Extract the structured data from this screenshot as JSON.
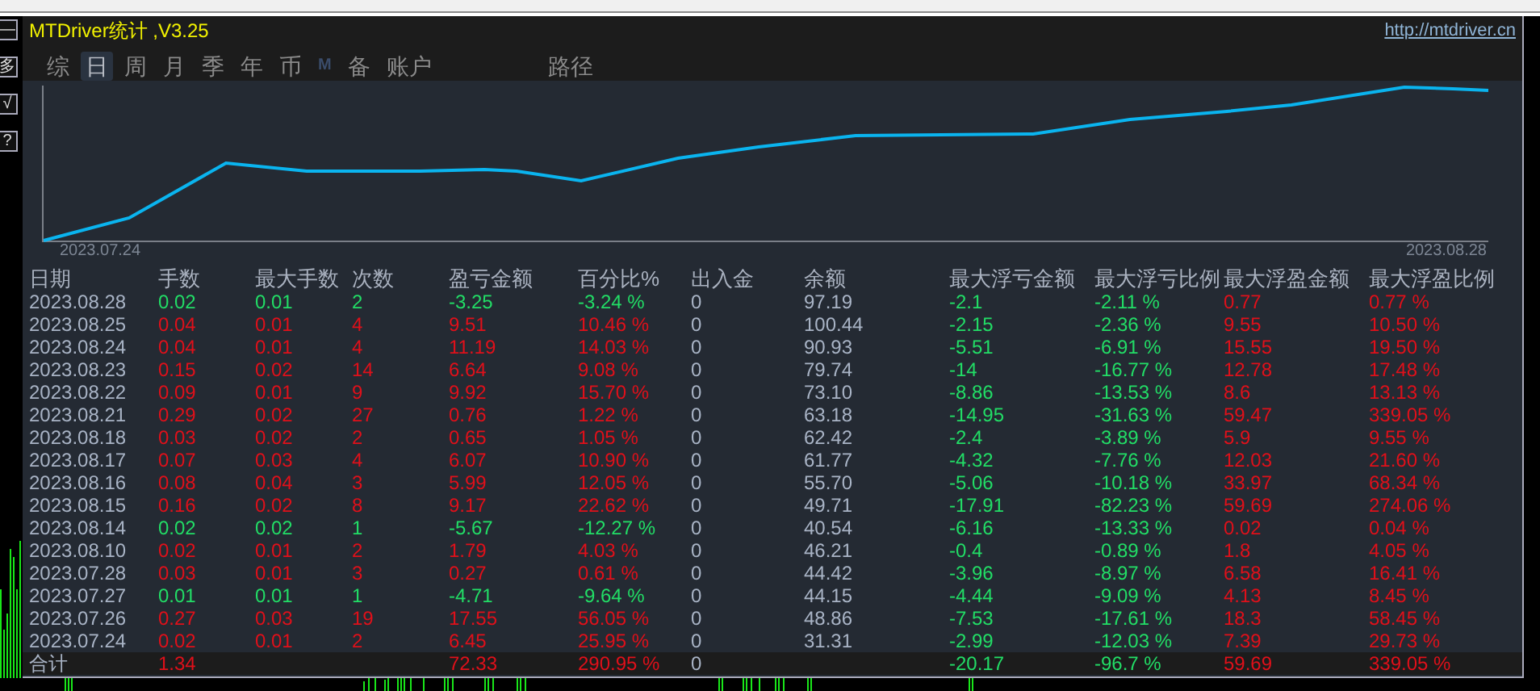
{
  "side_buttons": [
    "—",
    "多",
    "√",
    "?"
  ],
  "panel": {
    "title": "MTDriver统计 ,V3.25",
    "url": "http://mtdriver.cn"
  },
  "tabs": [
    {
      "label": "综",
      "selected": false,
      "disabled": false
    },
    {
      "label": "日",
      "selected": true,
      "disabled": false
    },
    {
      "label": "周",
      "selected": false,
      "disabled": false
    },
    {
      "label": "月",
      "selected": false,
      "disabled": false
    },
    {
      "label": "季",
      "selected": false,
      "disabled": false
    },
    {
      "label": "年",
      "selected": false,
      "disabled": false
    },
    {
      "label": "币",
      "selected": false,
      "disabled": false
    },
    {
      "label": "M",
      "selected": false,
      "disabled": true
    },
    {
      "label": "备",
      "selected": false,
      "disabled": false
    },
    {
      "label": "账户",
      "selected": false,
      "disabled": false
    }
  ],
  "path_button": "路径",
  "equity_chart": {
    "start_label": "2023.07.24",
    "end_label": "2023.08.28"
  },
  "table": {
    "columns": [
      {
        "label": "日期",
        "kind": "plain"
      },
      {
        "label": "手数",
        "kind": "result"
      },
      {
        "label": "最大手数",
        "kind": "result"
      },
      {
        "label": "次数",
        "kind": "result"
      },
      {
        "label": "盈亏金额",
        "kind": "result"
      },
      {
        "label": "百分比%",
        "kind": "result"
      },
      {
        "label": "出入金",
        "kind": "plain"
      },
      {
        "label": "余额",
        "kind": "plain"
      },
      {
        "label": "最大浮亏金额",
        "kind": "loss"
      },
      {
        "label": "最大浮亏比例",
        "kind": "loss"
      },
      {
        "label": "最大浮盈金额",
        "kind": "profit"
      },
      {
        "label": "最大浮盈比例",
        "kind": "profit"
      }
    ],
    "rows": [
      {
        "kind": "loss",
        "cells": [
          "2023.08.28",
          "0.02",
          "0.01",
          "2",
          "-3.25",
          "-3.24 %",
          "0",
          "97.19",
          "-2.1",
          "-2.11 %",
          "0.77",
          "0.77 %"
        ]
      },
      {
        "kind": "profit",
        "cells": [
          "2023.08.25",
          "0.04",
          "0.01",
          "4",
          "9.51",
          "10.46 %",
          "0",
          "100.44",
          "-2.15",
          "-2.36 %",
          "9.55",
          "10.50 %"
        ]
      },
      {
        "kind": "profit",
        "cells": [
          "2023.08.24",
          "0.04",
          "0.01",
          "4",
          "11.19",
          "14.03 %",
          "0",
          "90.93",
          "-5.51",
          "-6.91 %",
          "15.55",
          "19.50 %"
        ]
      },
      {
        "kind": "profit",
        "cells": [
          "2023.08.23",
          "0.15",
          "0.02",
          "14",
          "6.64",
          "9.08 %",
          "0",
          "79.74",
          "-14",
          "-16.77 %",
          "12.78",
          "17.48 %"
        ]
      },
      {
        "kind": "profit",
        "cells": [
          "2023.08.22",
          "0.09",
          "0.01",
          "9",
          "9.92",
          "15.70 %",
          "0",
          "73.10",
          "-8.86",
          "-13.53 %",
          "8.6",
          "13.13 %"
        ]
      },
      {
        "kind": "profit",
        "cells": [
          "2023.08.21",
          "0.29",
          "0.02",
          "27",
          "0.76",
          "1.22 %",
          "0",
          "63.18",
          "-14.95",
          "-31.63 %",
          "59.47",
          "339.05 %"
        ]
      },
      {
        "kind": "profit",
        "cells": [
          "2023.08.18",
          "0.03",
          "0.02",
          "2",
          "0.65",
          "1.05 %",
          "0",
          "62.42",
          "-2.4",
          "-3.89 %",
          "5.9",
          "9.55 %"
        ]
      },
      {
        "kind": "profit",
        "cells": [
          "2023.08.17",
          "0.07",
          "0.03",
          "4",
          "6.07",
          "10.90 %",
          "0",
          "61.77",
          "-4.32",
          "-7.76 %",
          "12.03",
          "21.60 %"
        ]
      },
      {
        "kind": "profit",
        "cells": [
          "2023.08.16",
          "0.08",
          "0.04",
          "3",
          "5.99",
          "12.05 %",
          "0",
          "55.70",
          "-5.06",
          "-10.18 %",
          "33.97",
          "68.34 %"
        ]
      },
      {
        "kind": "profit",
        "cells": [
          "2023.08.15",
          "0.16",
          "0.02",
          "8",
          "9.17",
          "22.62 %",
          "0",
          "49.71",
          "-17.91",
          "-82.23 %",
          "59.69",
          "274.06 %"
        ]
      },
      {
        "kind": "loss",
        "cells": [
          "2023.08.14",
          "0.02",
          "0.02",
          "1",
          "-5.67",
          "-12.27 %",
          "0",
          "40.54",
          "-6.16",
          "-13.33 %",
          "0.02",
          "0.04 %"
        ]
      },
      {
        "kind": "profit",
        "cells": [
          "2023.08.10",
          "0.02",
          "0.01",
          "2",
          "1.79",
          "4.03 %",
          "0",
          "46.21",
          "-0.4",
          "-0.89 %",
          "1.8",
          "4.05 %"
        ]
      },
      {
        "kind": "profit",
        "cells": [
          "2023.07.28",
          "0.03",
          "0.01",
          "3",
          "0.27",
          "0.61 %",
          "0",
          "44.42",
          "-3.96",
          "-8.97 %",
          "6.58",
          "16.41 %"
        ]
      },
      {
        "kind": "loss",
        "cells": [
          "2023.07.27",
          "0.01",
          "0.01",
          "1",
          "-4.71",
          "-9.64 %",
          "0",
          "44.15",
          "-4.44",
          "-9.09 %",
          "4.13",
          "8.45 %"
        ]
      },
      {
        "kind": "profit",
        "cells": [
          "2023.07.26",
          "0.27",
          "0.03",
          "19",
          "17.55",
          "56.05 %",
          "0",
          "48.86",
          "-7.53",
          "-17.61 %",
          "18.3",
          "58.45 %"
        ]
      },
      {
        "kind": "profit",
        "cells": [
          "2023.07.24",
          "0.02",
          "0.01",
          "2",
          "6.45",
          "25.95 %",
          "0",
          "31.31",
          "-2.99",
          "-12.03 %",
          "7.39",
          "29.73 %"
        ]
      }
    ],
    "total": {
      "kind": "profit",
      "cells": [
        "合计",
        "1.34",
        null,
        null,
        "72.33",
        "290.95 %",
        "0",
        null,
        "-20.17",
        "-96.7 %",
        "59.69",
        "339.05 %"
      ]
    }
  }
}
